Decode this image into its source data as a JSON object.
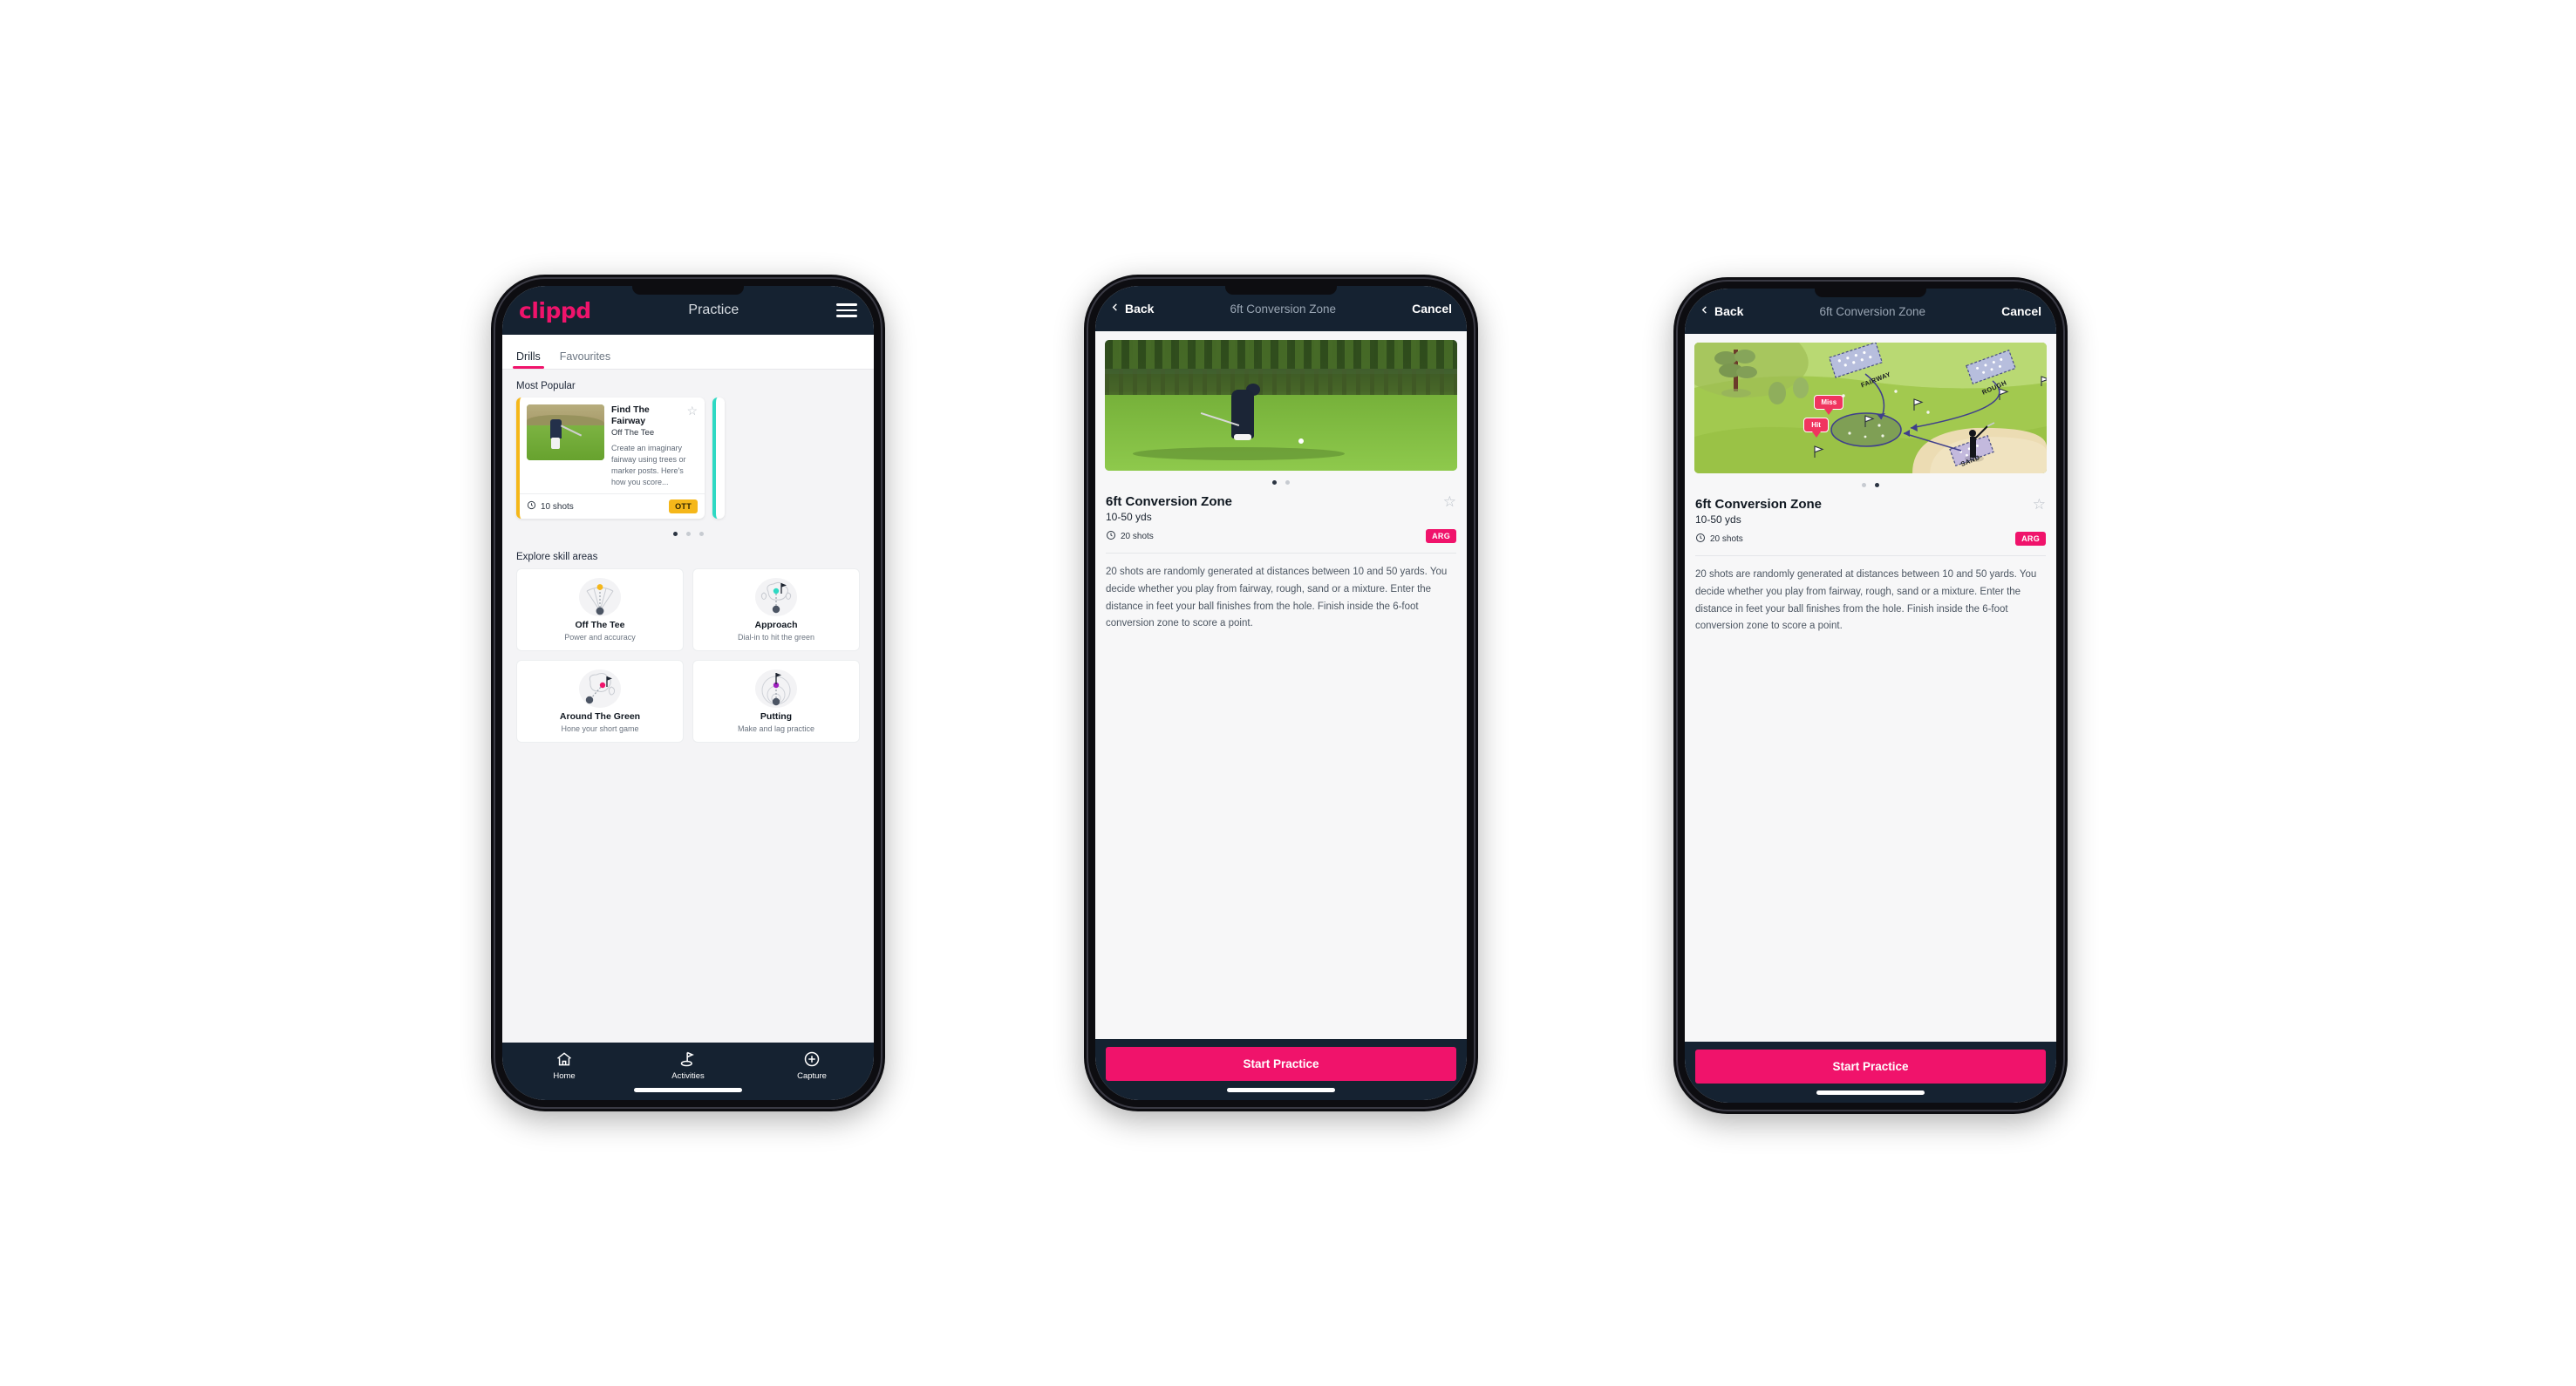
{
  "phone1": {
    "appbar": {
      "logo": "clippd",
      "title": "Practice",
      "menu_icon": "hamburger-icon"
    },
    "tabs": [
      {
        "label": "Drills",
        "active": true
      },
      {
        "label": "Favourites",
        "active": false
      }
    ],
    "sections": {
      "most_popular": "Most Popular",
      "explore": "Explore skill areas"
    },
    "drill_card": {
      "title": "Find The Fairway",
      "subtitle": "Off The Tee",
      "description": "Create an imaginary fairway using trees or marker posts. Here's how you score...",
      "shots": "10 shots",
      "badge": "OTT",
      "badge_color": "#f5b71a",
      "accent_color": "#f5b71a",
      "next_accent_color": "#2ed9c3",
      "star_icon": "star-outline-icon",
      "shots_icon": "clock-icon"
    },
    "carousel_dots": {
      "count": 3,
      "active_index": 0
    },
    "skills": [
      {
        "name": "Off The Tee",
        "desc": "Power and accuracy",
        "icon": "off-the-tee-icon",
        "dot_color": "#f5b71a"
      },
      {
        "name": "Approach",
        "desc": "Dial-in to hit the green",
        "icon": "approach-icon",
        "dot_color": "#2ed9c3"
      },
      {
        "name": "Around The Green",
        "desc": "Hone your short game",
        "icon": "around-the-green-icon",
        "dot_color": "#f0136b"
      },
      {
        "name": "Putting",
        "desc": "Make and lag practice",
        "icon": "putting-icon",
        "dot_color": "#a020c0"
      }
    ],
    "bottom_nav": [
      {
        "label": "Home",
        "icon": "home-icon",
        "active": false
      },
      {
        "label": "Activities",
        "icon": "golf-flag-icon",
        "active": true
      },
      {
        "label": "Capture",
        "icon": "plus-circle-icon",
        "active": false
      }
    ]
  },
  "phone2": {
    "appbar": {
      "back": "Back",
      "title": "6ft Conversion Zone",
      "cancel": "Cancel",
      "back_icon": "chevron-left-icon"
    },
    "media_kind": "video-thumbnail",
    "carousel_dots": {
      "count": 2,
      "active_index": 0
    },
    "detail": {
      "title": "6ft Conversion Zone",
      "subtitle": "10-50 yds",
      "shots": "20 shots",
      "badge": "ARG",
      "badge_color": "#f0136b",
      "star_icon": "star-outline-icon",
      "shots_icon": "clock-icon",
      "description": "20 shots are randomly generated at distances between 10 and 50 yards. You decide whether you play from fairway, rough, sand or a mixture. Enter the distance in feet your ball finishes from the hole. Finish inside the 6-foot conversion zone to score a point."
    },
    "cta": "Start Practice",
    "cta_color": "#f0136b"
  },
  "phone3": {
    "appbar": {
      "back": "Back",
      "title": "6ft Conversion Zone",
      "cancel": "Cancel",
      "back_icon": "chevron-left-icon"
    },
    "media_kind": "course-illustration",
    "course_labels": {
      "fairway": "FAIRWAY",
      "rough": "ROUGH",
      "sand": "SAND",
      "miss": "Miss",
      "hit": "Hit"
    },
    "carousel_dots": {
      "count": 2,
      "active_index": 1
    },
    "detail": {
      "title": "6ft Conversion Zone",
      "subtitle": "10-50 yds",
      "shots": "20 shots",
      "badge": "ARG",
      "badge_color": "#f0136b",
      "star_icon": "star-outline-icon",
      "shots_icon": "clock-icon",
      "description": "20 shots are randomly generated at distances between 10 and 50 yards. You decide whether you play from fairway, rough, sand or a mixture. Enter the distance in feet your ball finishes from the hole. Finish inside the 6-foot conversion zone to score a point."
    },
    "cta": "Start Practice",
    "cta_color": "#f0136b"
  },
  "theme": {
    "header_bg": "#152231",
    "accent_pink": "#f0136b",
    "page_bg": "#ffffff",
    "screen_bg": "#f4f4f6"
  }
}
